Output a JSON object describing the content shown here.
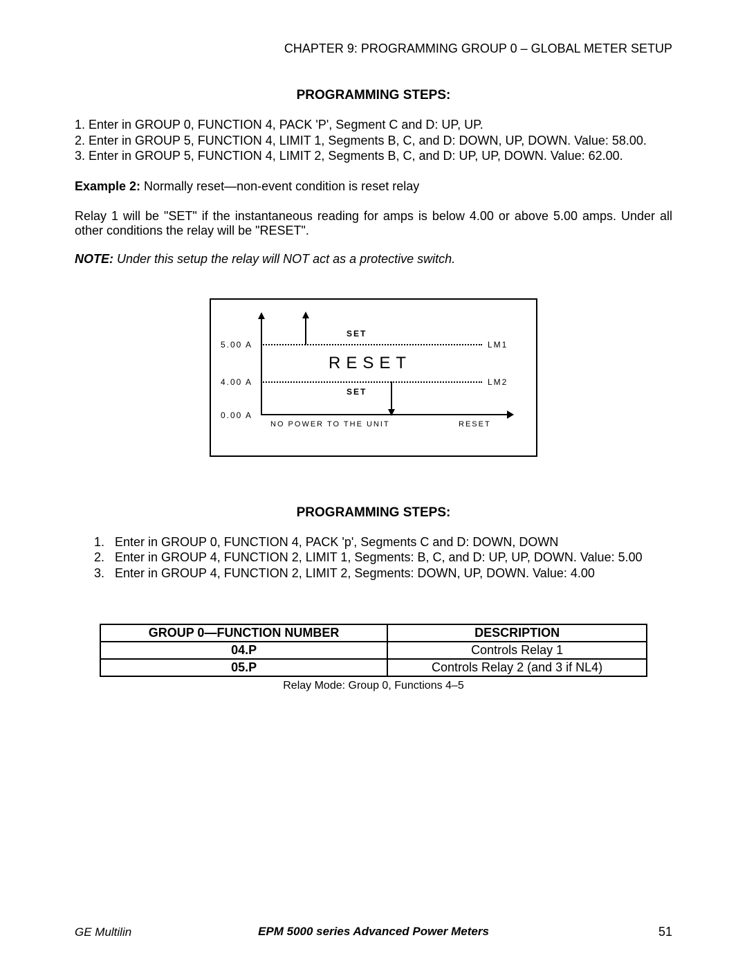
{
  "chapter_header": "CHAPTER 9: PROGRAMMING GROUP 0 – GLOBAL METER SETUP",
  "section1": {
    "title": "PROGRAMMING STEPS:",
    "steps": [
      "1. Enter in GROUP 0, FUNCTION 4, PACK 'P', Segment C and D: UP, UP.",
      "2. Enter in GROUP 5, FUNCTION 4, LIMIT 1, Segments B, C, and D:  DOWN, UP, DOWN. Value: 58.00.",
      "3. Enter in GROUP 5, FUNCTION 4, LIMIT 2, Segments B, C, and D:  UP, UP, DOWN. Value: 62.00."
    ]
  },
  "example2": {
    "label": "Example 2:",
    "text": " Normally reset—non-event condition is reset relay"
  },
  "relay_para": "Relay 1 will be \"SET\" if the instantaneous reading for amps is below 4.00 or above 5.00 amps. Under all other conditions the relay will be \"RESET\".",
  "note": {
    "label": "NOTE:",
    "text": "  Under this setup the relay will NOT act as a protective switch."
  },
  "chart_data": {
    "type": "line",
    "title": "",
    "y_ticks": [
      "5.00 A",
      "4.00 A",
      "0.00 A"
    ],
    "limits": [
      {
        "name": "LM1",
        "value": 5.0,
        "above": "SET",
        "between": "RESET"
      },
      {
        "name": "LM2",
        "value": 4.0,
        "below": "SET",
        "between": "RESET"
      }
    ],
    "regions": {
      "above_lm1": "SET",
      "between": "RESET",
      "below_lm2": "SET"
    },
    "x_axis_left_label": "NO POWER TO THE UNIT",
    "x_axis_right_label": "RESET",
    "set_label": "SET",
    "reset_label": "RESET",
    "lm1_label": "LM1",
    "lm2_label": "LM2"
  },
  "section2": {
    "title": "PROGRAMMING STEPS:",
    "steps": [
      {
        "n": "1.",
        "t": "Enter in GROUP 0, FUNCTION 4, PACK 'p',  Segments C and D:  DOWN, DOWN"
      },
      {
        "n": "2.",
        "t": "Enter in GROUP 4, FUNCTION 2, LIMIT 1, Segments: B, C, and D: UP, UP, DOWN.  Value: 5.00"
      },
      {
        "n": "3.",
        "t": "Enter in GROUP 4, FUNCTION 2, LIMIT 2, Segments: DOWN, UP, DOWN.  Value: 4.00"
      }
    ]
  },
  "table": {
    "headers": [
      "GROUP 0—FUNCTION NUMBER",
      "DESCRIPTION"
    ],
    "rows": [
      [
        "04.P",
        "Controls Relay 1"
      ],
      [
        "05.P",
        "Controls Relay 2 (and 3 if NL4)"
      ]
    ],
    "caption": "Relay Mode: Group 0, Functions 4–5"
  },
  "footer": {
    "left": "GE Multilin",
    "center": "EPM 5000 series Advanced Power Meters",
    "right": "51"
  }
}
